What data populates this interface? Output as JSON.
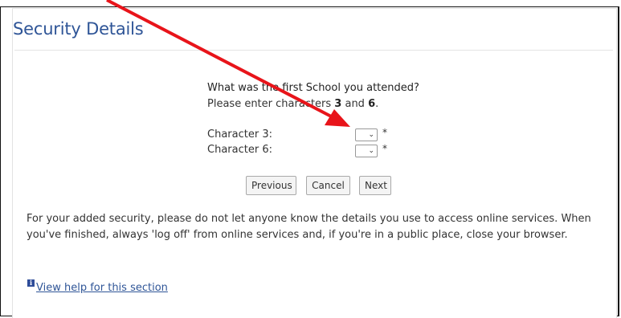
{
  "page": {
    "title": "Security Details",
    "question": "What was the first School you attended?",
    "instruction_prefix": "Please enter characters ",
    "char_a": "3",
    "instruction_and": " and ",
    "char_b": "6",
    "instruction_suffix": ".",
    "fields": [
      {
        "label": "Character 3:",
        "required_mark": "*"
      },
      {
        "label": "Character 6:",
        "required_mark": "*"
      }
    ],
    "buttons": {
      "previous": "Previous",
      "cancel": "Cancel",
      "next": "Next"
    },
    "notice": "For your added security, please do not let anyone know the details you use to access online services. When you've finished, always 'log off' from online services and, if you're in a public place, close your browser.",
    "help_link": "View help for this section",
    "info_icon_glyph": "i",
    "chevron_glyph": "⌄"
  },
  "colors": {
    "title": "#2f5597",
    "annotation_arrow": "#e8141a"
  }
}
